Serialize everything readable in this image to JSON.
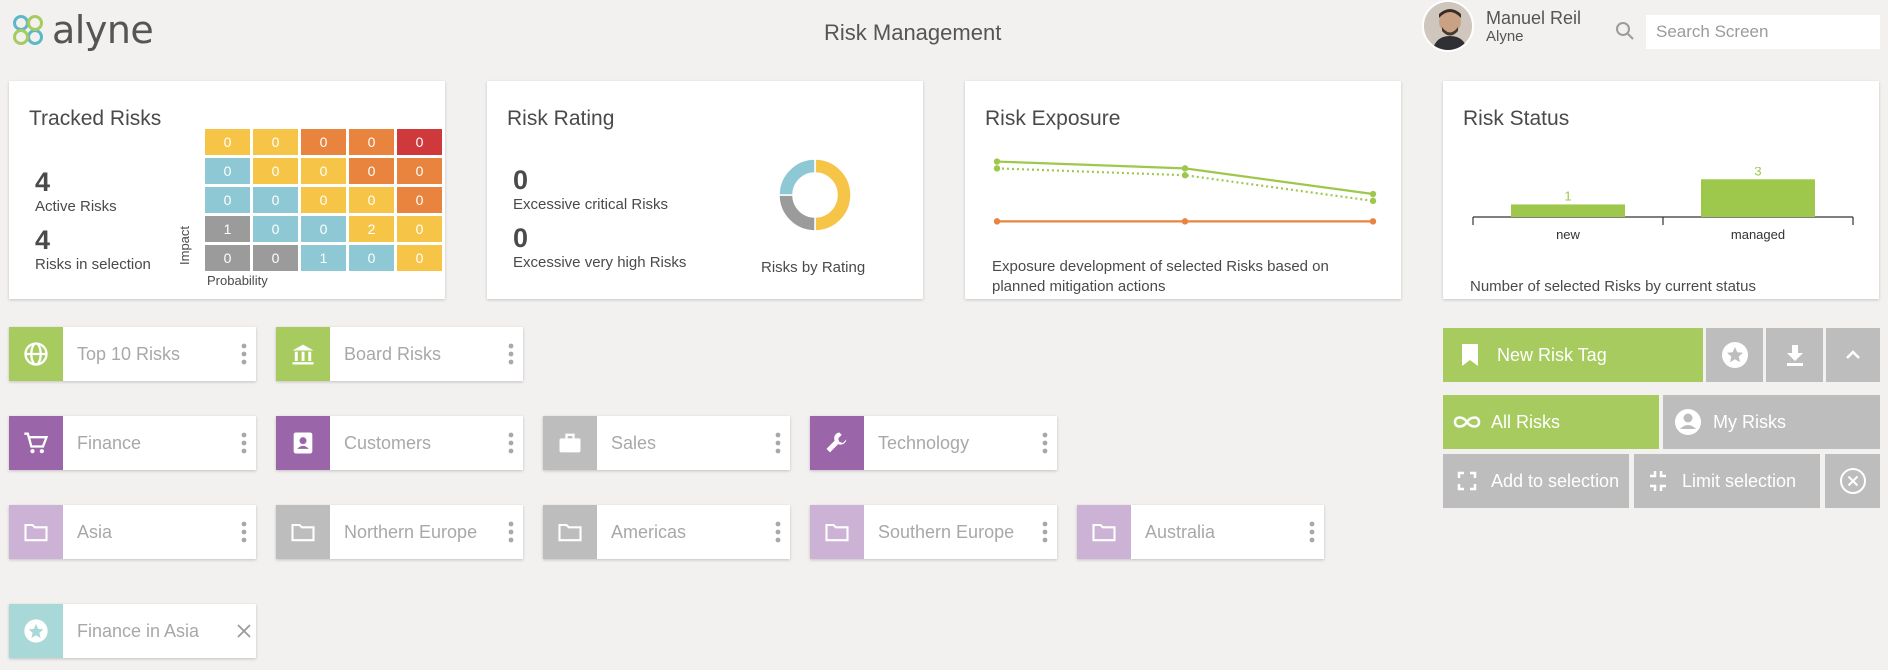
{
  "app": {
    "logo_text": "alyne",
    "page_title": "Risk Management"
  },
  "user": {
    "name": "Manuel Reil",
    "org": "Alyne"
  },
  "search": {
    "placeholder": "Search Screen"
  },
  "cards": {
    "tracked": {
      "title": "Tracked Risks",
      "active_count": "4",
      "active_label": "Active Risks",
      "selection_count": "4",
      "selection_label": "Risks in selection",
      "impact_label": "Impact",
      "probability_label": "Probability",
      "matrix": [
        [
          "0",
          "0",
          "0",
          "0",
          "0"
        ],
        [
          "0",
          "0",
          "0",
          "0",
          "0"
        ],
        [
          "0",
          "0",
          "0",
          "0",
          "0"
        ],
        [
          "1",
          "0",
          "0",
          "2",
          "0"
        ],
        [
          "0",
          "0",
          "1",
          "0",
          "0"
        ]
      ],
      "matrix_colors": [
        [
          "#f6c547",
          "#f6c547",
          "#e8843e",
          "#e8843e",
          "#d0393b"
        ],
        [
          "#8ec8d4",
          "#f6c547",
          "#f6c547",
          "#e8843e",
          "#e8843e"
        ],
        [
          "#8ec8d4",
          "#8ec8d4",
          "#f6c547",
          "#f6c547",
          "#e8843e"
        ],
        [
          "#9b9b9b",
          "#8ec8d4",
          "#8ec8d4",
          "#f6c547",
          "#f6c547"
        ],
        [
          "#9b9b9b",
          "#9b9b9b",
          "#8ec8d4",
          "#8ec8d4",
          "#f6c547"
        ]
      ]
    },
    "rating": {
      "title": "Risk Rating",
      "critical_count": "0",
      "critical_label": "Excessive critical Risks",
      "veryhigh_count": "0",
      "veryhigh_label": "Excessive very high Risks",
      "donut_label": "Risks by Rating",
      "donut": [
        {
          "value": 50,
          "color": "#f6c547"
        },
        {
          "value": 25,
          "color": "#9b9b9b"
        },
        {
          "value": 25,
          "color": "#8ec8d4"
        }
      ]
    },
    "exposure": {
      "title": "Risk Exposure",
      "caption_line1": "Exposure development of selected Risks based on",
      "caption_line2": "planned mitigation actions"
    },
    "status": {
      "title": "Risk Status",
      "caption": "Number of selected Risks by current status"
    }
  },
  "chart_data": [
    {
      "type": "line",
      "x": [
        0,
        1,
        2
      ],
      "series": [
        {
          "values": [
            100,
            96,
            81
          ],
          "color": "#9dc84c",
          "style": "solid"
        },
        {
          "values": [
            96,
            92,
            77
          ],
          "color": "#9dc84c",
          "style": "dotted"
        },
        {
          "values": [
            65,
            65,
            65
          ],
          "color": "#e8843e",
          "style": "solid"
        }
      ],
      "ylim": [
        50,
        105
      ]
    },
    {
      "type": "bar",
      "categories": [
        "new",
        "managed"
      ],
      "values": [
        1,
        3
      ],
      "ylim": [
        0,
        3.5
      ],
      "color": "#9dc84c"
    }
  ],
  "tiles": [
    {
      "label": "Top 10 Risks",
      "icon": "globe-icon",
      "color": "#a7cb5f",
      "menu": "dots"
    },
    {
      "label": "Board Risks",
      "icon": "bank-icon",
      "color": "#a7cb5f",
      "menu": "dots"
    },
    {
      "label": "Finance",
      "icon": "cart-icon",
      "color": "#9b66a9",
      "menu": "dots"
    },
    {
      "label": "Customers",
      "icon": "contact-icon",
      "color": "#9b66a9",
      "menu": "dots"
    },
    {
      "label": "Sales",
      "icon": "briefcase-icon",
      "color": "#bdbdbd",
      "menu": "dots"
    },
    {
      "label": "Technology",
      "icon": "wrench-icon",
      "color": "#9b66a9",
      "menu": "dots"
    },
    {
      "label": "Asia",
      "icon": "folder-icon",
      "color": "#ccb3d6",
      "menu": "dots"
    },
    {
      "label": "Northern Europe",
      "icon": "folder-icon",
      "color": "#bdbdbd",
      "menu": "dots"
    },
    {
      "label": "Americas",
      "icon": "folder-icon",
      "color": "#bdbdbd",
      "menu": "dots"
    },
    {
      "label": "Southern Europe",
      "icon": "folder-icon",
      "color": "#ccb3d6",
      "menu": "dots"
    },
    {
      "label": "Australia",
      "icon": "folder-icon",
      "color": "#ccb3d6",
      "menu": "dots"
    },
    {
      "label": "Finance in Asia",
      "icon": "star-icon",
      "color": "#a8d8d8",
      "menu": "close"
    }
  ],
  "actions": {
    "new_tag": "New Risk Tag",
    "all_risks": "All Risks",
    "my_risks": "My Risks",
    "add_selection": "Add to selection",
    "limit_selection": "Limit selection"
  },
  "colors": {
    "green": "#a7cb5f",
    "grey": "#bdbdbd",
    "orange": "#e8843e"
  }
}
